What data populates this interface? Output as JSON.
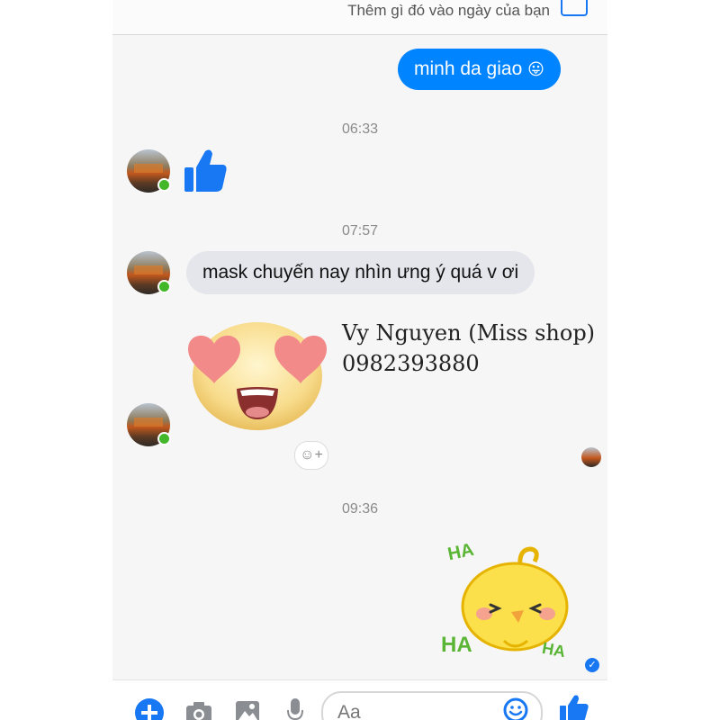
{
  "header": {
    "status_prompt": "Thêm gì đó vào ngày của bạn"
  },
  "messages": {
    "outgoing_1": "minh da giao",
    "outgoing_1_emoji": "😛",
    "time_1": "06:33",
    "time_2": "07:57",
    "incoming_text": "mask chuyến nay nhìn ưng ý quá v ơi",
    "time_3": "09:36",
    "sticker_text": {
      "ha_top": "HA",
      "ha_left": "HA",
      "ha_right": "HA"
    }
  },
  "watermark": {
    "name": "Vy Nguyen (Miss shop)",
    "phone": "0982393880"
  },
  "composer": {
    "placeholder": "Aa"
  },
  "icons": [
    "add-icon",
    "camera-icon",
    "image-icon",
    "microphone-icon",
    "emoji-icon",
    "like-icon",
    "seen-check-icon",
    "thumbs-up-icon"
  ],
  "colors": {
    "messenger_blue": "#0084ff",
    "icon_blue": "#1877f2",
    "online_green": "#42b72a"
  }
}
